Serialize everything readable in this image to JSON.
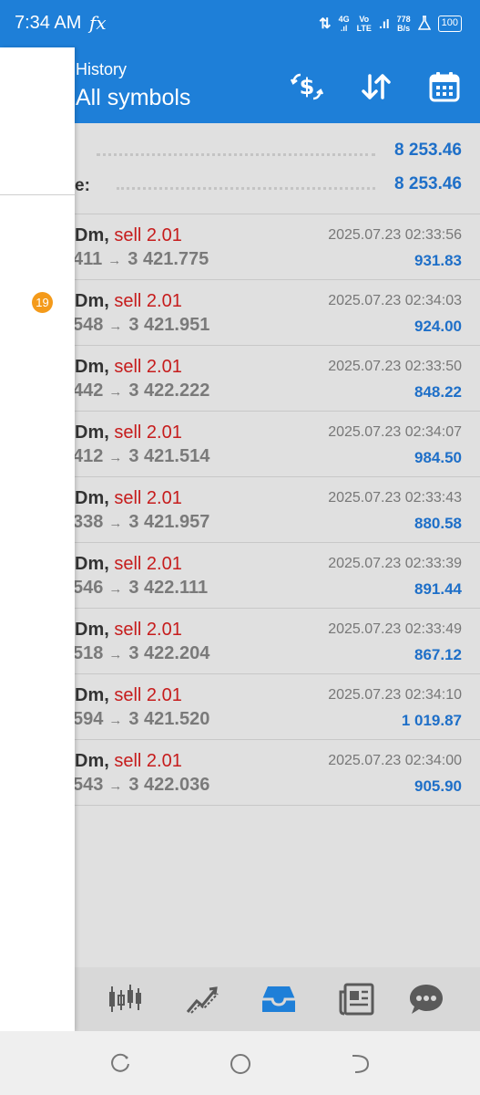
{
  "status_bar": {
    "time": "7:34 AM",
    "fx_label": "fx",
    "net_icon": "⇅",
    "signal1_top": "4G",
    "signal2_top": "Vo",
    "signal2_bottom": "LTE",
    "speed_value": "778",
    "speed_unit": "B/s",
    "battery": "100"
  },
  "appbar": {
    "subtitle": "History",
    "title": "All symbols",
    "icons": [
      "dollar-exchange-icon",
      "sort-icon",
      "calendar-icon"
    ]
  },
  "summary": [
    {
      "label": "",
      "value": "8 253.46"
    },
    {
      "label": "e:",
      "value": "8 253.46"
    }
  ],
  "trades": [
    {
      "symbol": "Dm,",
      "side": "sell 2.01",
      "open_price": "411",
      "close_price": "3 421.775",
      "time": "2025.07.23 02:33:56",
      "profit": "931.83"
    },
    {
      "symbol": "Dm,",
      "side": "sell 2.01",
      "open_price": "548",
      "close_price": "3 421.951",
      "time": "2025.07.23 02:34:03",
      "profit": "924.00"
    },
    {
      "symbol": "Dm,",
      "side": "sell 2.01",
      "open_price": "442",
      "close_price": "3 422.222",
      "time": "2025.07.23 02:33:50",
      "profit": "848.22"
    },
    {
      "symbol": "Dm,",
      "side": "sell 2.01",
      "open_price": "412",
      "close_price": "3 421.514",
      "time": "2025.07.23 02:34:07",
      "profit": "984.50"
    },
    {
      "symbol": "Dm,",
      "side": "sell 2.01",
      "open_price": "338",
      "close_price": "3 421.957",
      "time": "2025.07.23 02:33:43",
      "profit": "880.58"
    },
    {
      "symbol": "Dm,",
      "side": "sell 2.01",
      "open_price": "546",
      "close_price": "3 422.111",
      "time": "2025.07.23 02:33:39",
      "profit": "891.44"
    },
    {
      "symbol": "Dm,",
      "side": "sell 2.01",
      "open_price": "518",
      "close_price": "3 422.204",
      "time": "2025.07.23 02:33:49",
      "profit": "867.12"
    },
    {
      "symbol": "Dm,",
      "side": "sell 2.01",
      "open_price": "594",
      "close_price": "3 421.520",
      "time": "2025.07.23 02:34:10",
      "profit": "1 019.87"
    },
    {
      "symbol": "Dm,",
      "side": "sell 2.01",
      "open_price": "543",
      "close_price": "3 422.036",
      "time": "2025.07.23 02:34:00",
      "profit": "905.90"
    }
  ],
  "arrow_glyph": "→",
  "drawer": {
    "badge_count": "19"
  },
  "bottom_nav": {
    "items": [
      "quotes-icon",
      "chart-icon",
      "history-inbox-icon",
      "news-icon",
      "chat-icon"
    ],
    "active": "history-inbox-icon"
  },
  "system_nav": [
    "recents-icon",
    "home-icon",
    "back-icon"
  ],
  "colors": {
    "accent": "#1e7fd8",
    "sell": "#c61c1c",
    "profit": "#1e6fc8",
    "badge": "#f49a1a",
    "icon_gray": "#5a5a5a"
  }
}
